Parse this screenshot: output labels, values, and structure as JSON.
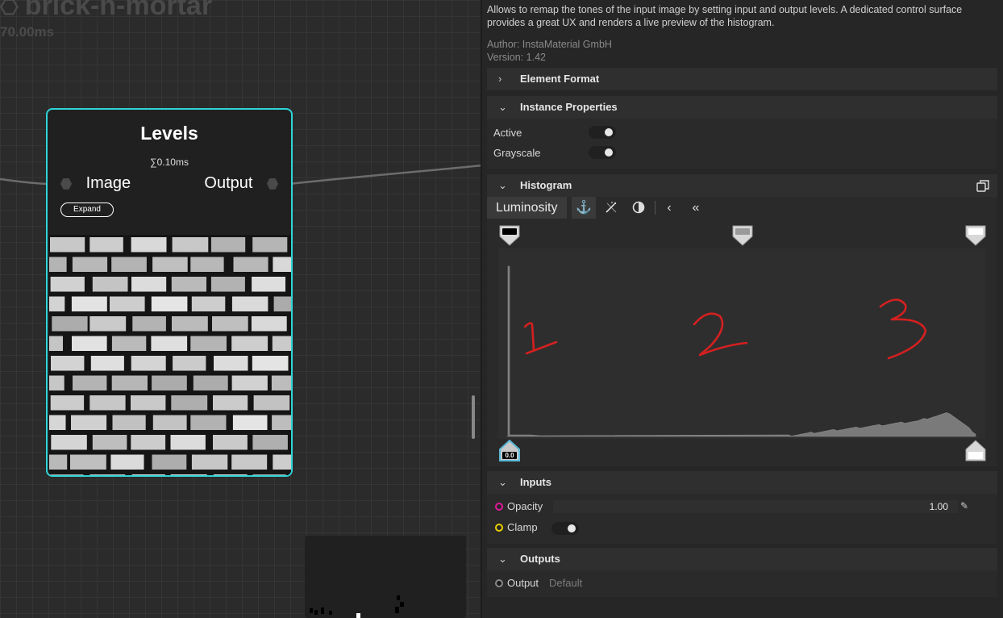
{
  "graph": {
    "title": "brick-n-mortar",
    "time": "70.00ms"
  },
  "node": {
    "title": "Levels",
    "time": "∑0.10ms",
    "input_port": "Image",
    "output_port": "Output",
    "expand_label": "Expand",
    "border_color": "#2fd4d8"
  },
  "panel": {
    "description": "Allows to remap the tones of the input image by setting input and output levels. A dedicated control surface provides a great UX and renders a live preview of the histogram.",
    "author": "Author: InstaMaterial GmbH",
    "version": "Version: 1.42",
    "sections": {
      "element_format": "Element Format",
      "instance_properties": "Instance Properties",
      "histogram": "Histogram",
      "inputs": "Inputs",
      "outputs": "Outputs"
    },
    "instance": {
      "active_label": "Active",
      "grayscale_label": "Grayscale"
    },
    "histogram": {
      "channel": "Luminosity",
      "output_low_value": "0.0",
      "annotations": [
        "1",
        "2",
        "3"
      ],
      "annotation_color": "#d42020",
      "icons": [
        "anchor-icon",
        "magic-wand-icon",
        "contrast-icon",
        "chevron-left-icon",
        "double-chevron-left-icon"
      ]
    },
    "inputs": {
      "opacity_label": "Opacity",
      "opacity_value": "1.00",
      "opacity_color": "#e0189a",
      "clamp_label": "Clamp",
      "clamp_color": "#e8d000"
    },
    "outputs": {
      "output_label": "Output",
      "output_value": "Default"
    }
  }
}
